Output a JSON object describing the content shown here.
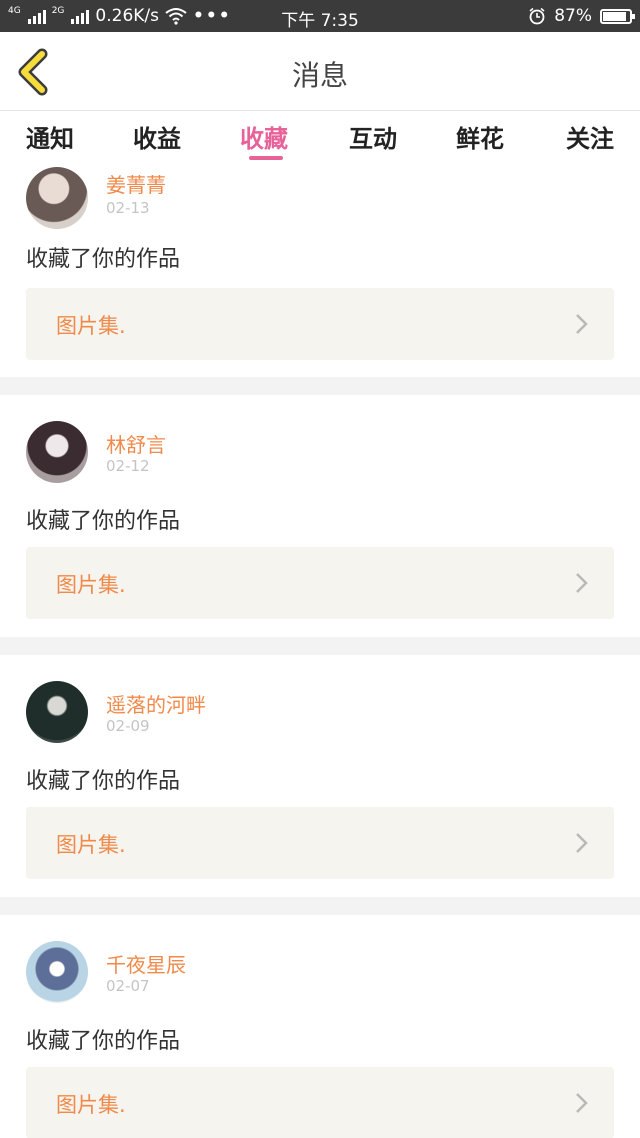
{
  "status_bar": {
    "net_a": "4G",
    "net_b": "2G",
    "speed": "0.26K/s",
    "time": "下午 7:35",
    "battery": "87%",
    "battery_level": 0.87
  },
  "header": {
    "title": "消息"
  },
  "tabs": [
    {
      "label": "通知"
    },
    {
      "label": "收益"
    },
    {
      "label": "收藏"
    },
    {
      "label": "互动"
    },
    {
      "label": "鲜花"
    },
    {
      "label": "关注"
    }
  ],
  "active_tab": 2,
  "colors": {
    "accent_pink": "#e8629a",
    "name_orange": "#f08a4b",
    "work_bg": "#f5f4ee"
  },
  "items": [
    {
      "username": "姜菁菁",
      "date": "02-13",
      "action": "收藏了你的作品",
      "work_label": "图片集."
    },
    {
      "username": "林舒言",
      "date": "02-12",
      "action": "收藏了你的作品",
      "work_label": "图片集."
    },
    {
      "username": "遥落的河畔",
      "date": "02-09",
      "action": "收藏了你的作品",
      "work_label": "图片集."
    },
    {
      "username": "千夜星辰",
      "date": "02-07",
      "action": "收藏了你的作品",
      "work_label": "图片集."
    }
  ]
}
